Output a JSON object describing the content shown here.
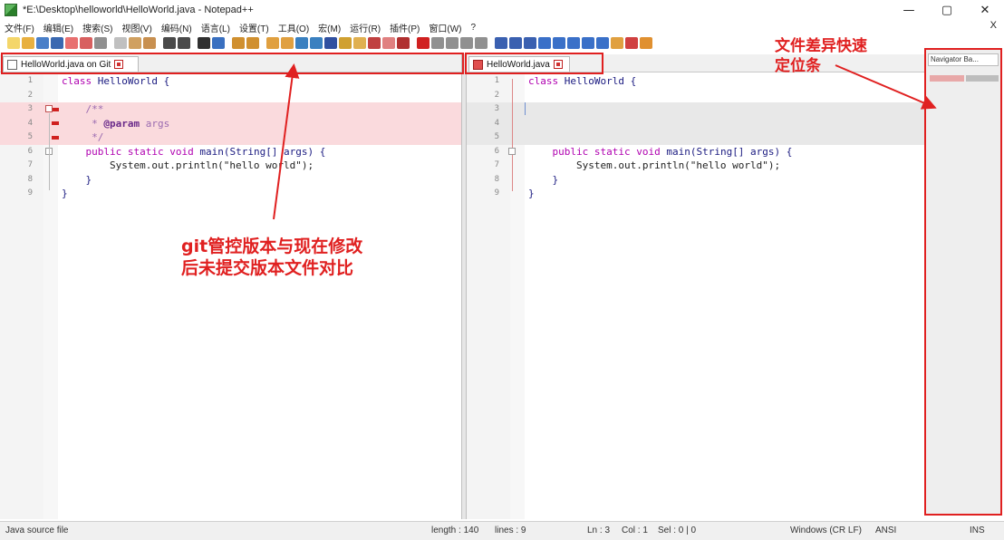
{
  "window": {
    "title": "*E:\\Desktop\\helloworld\\HelloWorld.java - Notepad++",
    "minimize": "—",
    "maximize": "▢",
    "close": "✕"
  },
  "menu": {
    "items": [
      "文件(F)",
      "编辑(E)",
      "搜索(S)",
      "视图(V)",
      "编码(N)",
      "语言(L)",
      "设置(T)",
      "工具(O)",
      "宏(M)",
      "运行(R)",
      "插件(P)",
      "窗口(W)",
      "?"
    ],
    "close_x": "X"
  },
  "tabs": {
    "left_label": "HelloWorld.java on Git",
    "right_label": "HelloWorld.java"
  },
  "locator": {
    "header": "Navigator Ba..."
  },
  "left_pane": {
    "lines": [
      {
        "n": "1",
        "text": "class HelloWorld {"
      },
      {
        "n": "2",
        "text": ""
      },
      {
        "n": "3",
        "text": "    /**"
      },
      {
        "n": "4",
        "text": "     * @param args"
      },
      {
        "n": "5",
        "text": "     */"
      },
      {
        "n": "6",
        "text": "    public static void main(String[] args) {"
      },
      {
        "n": "7",
        "text": "        System.out.println(\"hello world\");"
      },
      {
        "n": "8",
        "text": "    }"
      },
      {
        "n": "9",
        "text": "}"
      }
    ]
  },
  "right_pane": {
    "lines": [
      {
        "n": "1",
        "text": "class HelloWorld {"
      },
      {
        "n": "2",
        "text": ""
      },
      {
        "n": "3",
        "text": ""
      },
      {
        "n": "4",
        "text": ""
      },
      {
        "n": "5",
        "text": "    public static void main(String[] args) {"
      },
      {
        "n": "6",
        "text": "        System.out.println(\"hello world\");"
      },
      {
        "n": "7",
        "text": "    }"
      },
      {
        "n": "8",
        "text": "}"
      },
      {
        "n": "9",
        "text": ""
      }
    ]
  },
  "status": {
    "file_type": "Java source file",
    "length": "length : 140",
    "lines": "lines : 9",
    "ln": "Ln : 3",
    "col": "Col : 1",
    "sel": "Sel : 0 | 0",
    "eol": "Windows (CR LF)",
    "encoding": "ANSI",
    "mode": "INS"
  },
  "annotations": {
    "left_line1": "git管控版本与现在修改",
    "left_line2": "后未提交版本文件对比",
    "right_line1": "文件差异快速",
    "right_line2": "定位条"
  },
  "colors": {
    "annotation": "#e02020",
    "diff_removed": "#fadadd",
    "diff_placeholder": "#e8e8e8"
  }
}
